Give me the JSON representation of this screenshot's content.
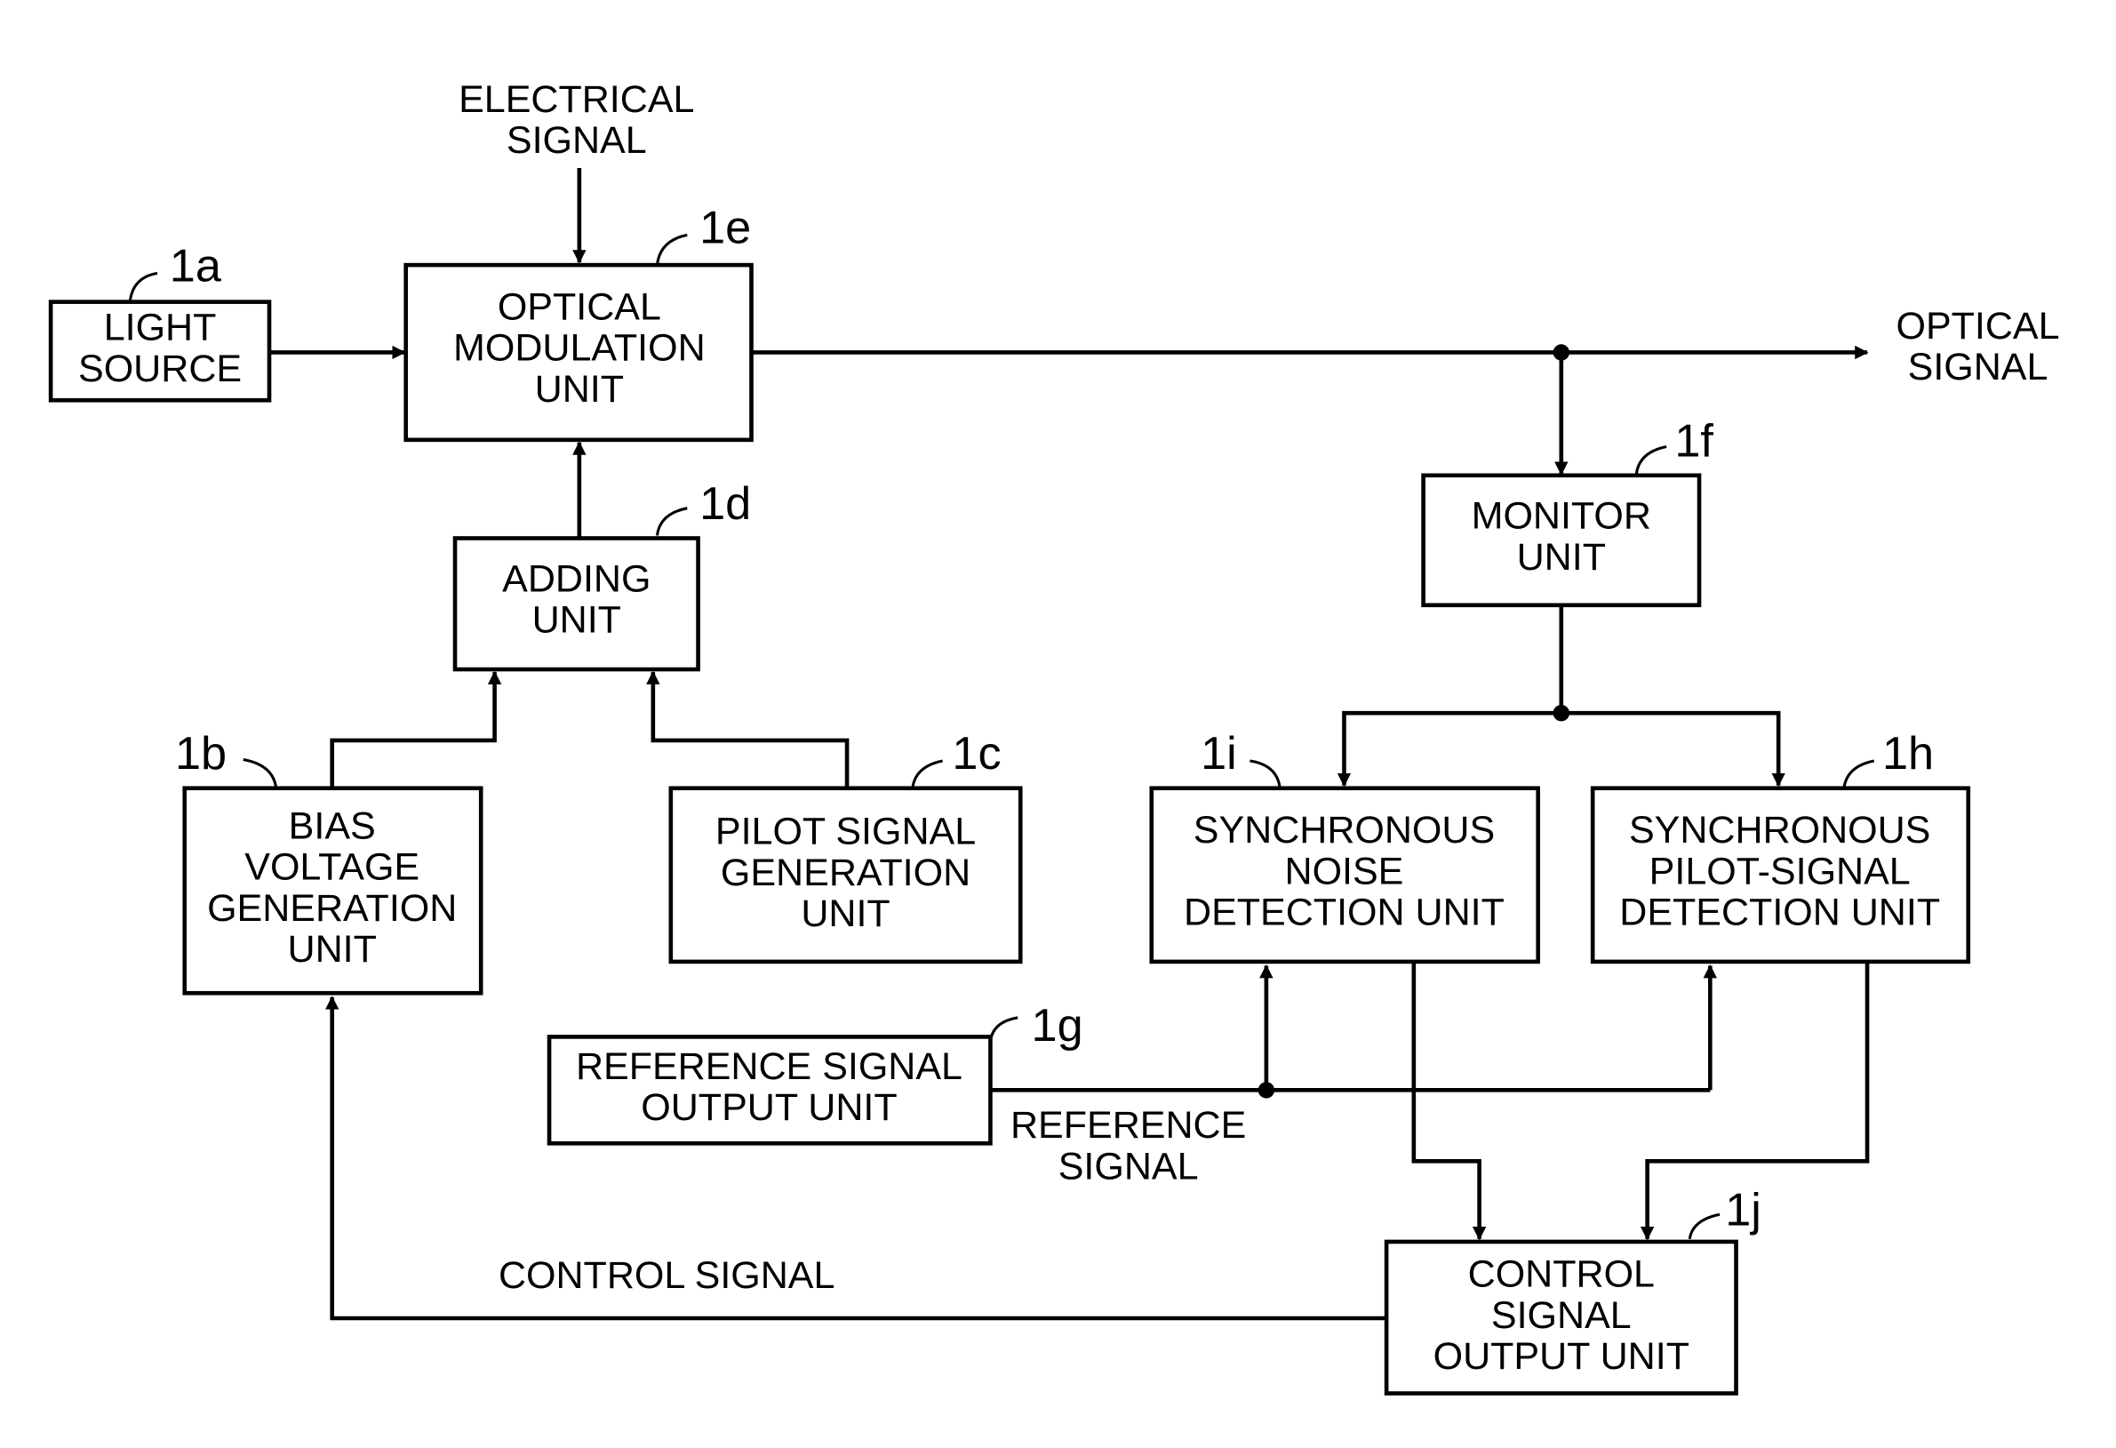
{
  "blocks": {
    "light_source": {
      "ref": "1a",
      "lines": [
        "LIGHT",
        "SOURCE"
      ]
    },
    "bias_voltage": {
      "ref": "1b",
      "lines": [
        "BIAS",
        "VOLTAGE",
        "GENERATION",
        "UNIT"
      ]
    },
    "pilot_signal": {
      "ref": "1c",
      "lines": [
        "PILOT SIGNAL",
        "GENERATION",
        "UNIT"
      ]
    },
    "adding": {
      "ref": "1d",
      "lines": [
        "ADDING",
        "UNIT"
      ]
    },
    "optical_modulation": {
      "ref": "1e",
      "lines": [
        "OPTICAL",
        "MODULATION",
        "UNIT"
      ]
    },
    "monitor": {
      "ref": "1f",
      "lines": [
        "MONITOR",
        "UNIT"
      ]
    },
    "reference_signal_output": {
      "ref": "1g",
      "lines": [
        "REFERENCE SIGNAL",
        "OUTPUT UNIT"
      ]
    },
    "sync_pilot_detection": {
      "ref": "1h",
      "lines": [
        "SYNCHRONOUS",
        "PILOT-SIGNAL",
        "DETECTION UNIT"
      ]
    },
    "sync_noise_detection": {
      "ref": "1i",
      "lines": [
        "SYNCHRONOUS",
        "NOISE",
        "DETECTION UNIT"
      ]
    },
    "control_signal_output": {
      "ref": "1j",
      "lines": [
        "CONTROL",
        "SIGNAL",
        "OUTPUT UNIT"
      ]
    }
  },
  "signals": {
    "electrical": [
      "ELECTRICAL",
      "SIGNAL"
    ],
    "optical": [
      "OPTICAL",
      "SIGNAL"
    ],
    "reference": [
      "REFERENCE",
      "SIGNAL"
    ],
    "control": "CONTROL SIGNAL"
  }
}
